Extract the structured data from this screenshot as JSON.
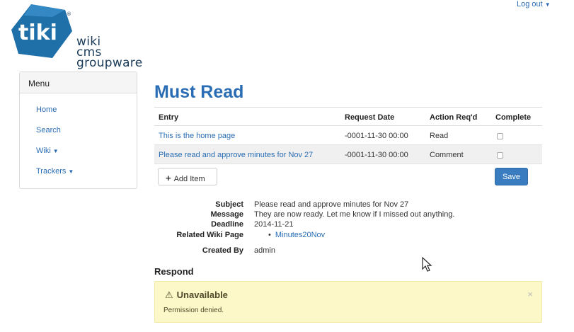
{
  "header": {
    "logout_label": "Log out",
    "logo": {
      "badge": "tiki",
      "lines": [
        "wiki",
        "cms",
        "groupware"
      ]
    }
  },
  "menu": {
    "title": "Menu",
    "items": [
      {
        "label": "Home",
        "dropdown": false
      },
      {
        "label": "Search",
        "dropdown": false
      },
      {
        "label": "Wiki",
        "dropdown": true
      },
      {
        "label": "Trackers",
        "dropdown": true
      }
    ]
  },
  "main": {
    "title": "Must Read",
    "columns": [
      "Entry",
      "Request Date",
      "Action Req'd",
      "Complete"
    ],
    "rows": [
      {
        "entry": "This is the home page",
        "date": "-0001-11-30 00:00",
        "action": "Read",
        "complete": false
      },
      {
        "entry": "Please read and approve minutes for Nov 27",
        "date": "-0001-11-30 00:00",
        "action": "Comment",
        "complete": false
      }
    ],
    "add_item_label": "Add Item",
    "save_label": "Save"
  },
  "details": {
    "subject_label": "Subject",
    "subject": "Please read and approve minutes for Nov 27",
    "message_label": "Message",
    "message": "They are now ready. Let me know if I missed out anything.",
    "deadline_label": "Deadline",
    "deadline": "2014-11-21",
    "related_label": "Related Wiki Page",
    "related_page": "Minutes20Nov",
    "created_label": "Created By",
    "created_by": "admin"
  },
  "respond": {
    "heading": "Respond",
    "alert_title": "Unavailable",
    "alert_text": "Permission denied.",
    "alert_close": "×"
  },
  "colors": {
    "link": "#2a6db4",
    "primary_button": "#3a7cc0",
    "warning_bg": "#fcf8c8",
    "logo_blue": "#1f6fa8"
  },
  "icons": [
    "chevron-down-icon",
    "plus-icon",
    "warning-icon",
    "close-icon",
    "mouse-cursor-icon"
  ]
}
